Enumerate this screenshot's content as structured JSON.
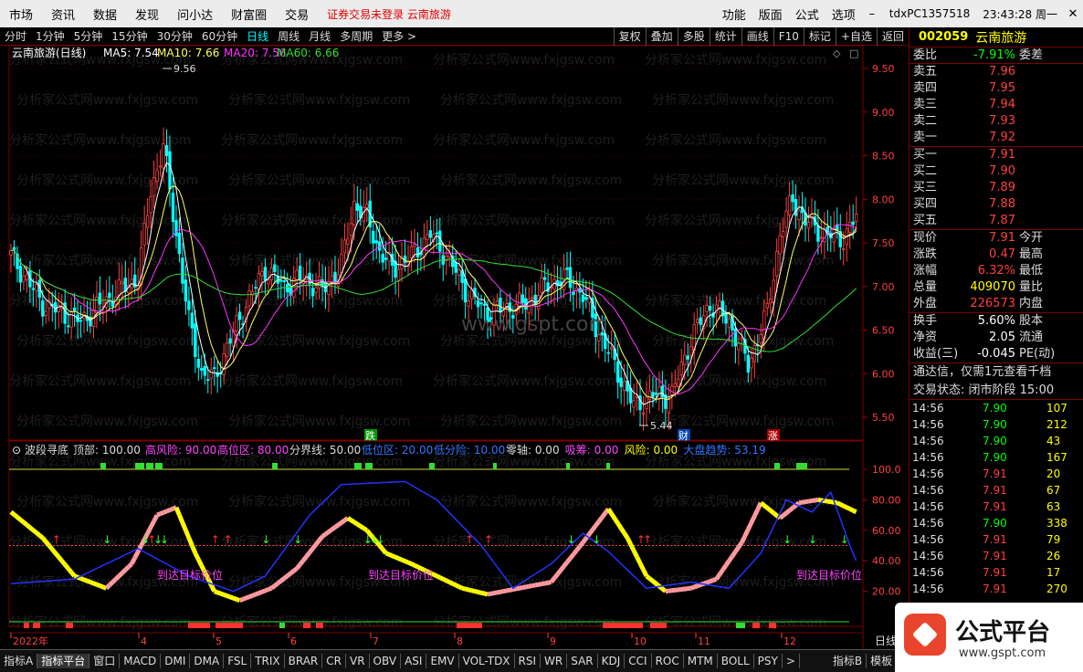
{
  "menu": {
    "items": [
      "市场",
      "资讯",
      "数据",
      "发现",
      "问小达",
      "财富圈",
      "交易"
    ],
    "warning": "证券交易未登录  云南旅游",
    "right_items": [
      "功能",
      "版面",
      "公式",
      "选项"
    ],
    "user": "tdxPC1357518",
    "clock": "23:43:28 周一"
  },
  "toolbar": {
    "periods": [
      "分时",
      "1分钟",
      "5分钟",
      "15分钟",
      "30分钟",
      "60分钟",
      "日线",
      "周线",
      "月线",
      "多周期",
      "更多 >"
    ],
    "active_period": "日线",
    "buttons": [
      "复权",
      "叠加",
      "多股",
      "统计",
      "画线",
      "F10",
      "标记",
      "+自选",
      "返回"
    ]
  },
  "main_chart": {
    "title": "云南旅游(日线)",
    "ma": [
      {
        "label": "MA5: 7.54",
        "color": "#ffffff"
      },
      {
        "label": "MA10: 7.66",
        "color": "#ffff66"
      },
      {
        "label": "MA20: 7.56",
        "color": "#ff33ff"
      },
      {
        "label": "MA60: 6.66",
        "color": "#33dd33"
      }
    ],
    "y_ticks": [
      "9.50",
      "9.00",
      "8.50",
      "8.00",
      "7.50",
      "7.00",
      "6.50",
      "6.00",
      "5.50"
    ],
    "high_label": "9.56",
    "low_label": "5.44",
    "markers": [
      "跌",
      "财",
      "涨"
    ],
    "watermark": "分析家公式网www.fxjgsw.com",
    "center_mark": "www.gspt.com"
  },
  "indicator": {
    "name": "波段寻底",
    "params": [
      {
        "label": "顶部: 100.00",
        "color": "#dddddd"
      },
      {
        "label": "高风险: 90.00",
        "color": "#ff44ff"
      },
      {
        "label": "高位区: 80.00",
        "color": "#ff44ff"
      },
      {
        "label": "分界线: 50.00",
        "color": "#dddddd"
      },
      {
        "label": "低位区: 20.00",
        "color": "#3377ff"
      },
      {
        "label": "低分险: 10.00",
        "color": "#3377ff"
      },
      {
        "label": "零轴: 0.00",
        "color": "#dddddd"
      },
      {
        "label": "吸筹: 0.00",
        "color": "#ff44ff"
      },
      {
        "label": "风险: 0.00",
        "color": "#ffff00"
      },
      {
        "label": "大盘趋势: 53.19",
        "color": "#3377ff"
      }
    ],
    "y_ticks": [
      "100.0",
      "80.00",
      "60.00",
      "40.00",
      "20.00"
    ],
    "annotation": "到达目标价位"
  },
  "x_axis": {
    "labels": [
      "2022年",
      "4",
      "5",
      "6",
      "7",
      "8",
      "9",
      "10",
      "11",
      "12"
    ],
    "tail": "日线"
  },
  "bottom_tabs": [
    "指标A",
    "指标平台",
    "窗口",
    "MACD",
    "DMI",
    "DMA",
    "FSL",
    "TRIX",
    "BRAR",
    "CR",
    "VR",
    "OBV",
    "ASI",
    "EMV",
    "VOL-TDX",
    "RSI",
    "WR",
    "SAR",
    "KDJ",
    "CCI",
    "ROC",
    "MTM",
    "BOLL",
    "PSY",
    ">",
    "指标B",
    "模板",
    "+"
  ],
  "quote": {
    "code": "002059",
    "name": "云南旅游",
    "weibi_label": "委比",
    "weibi_value": "-7.91%",
    "weicha_label": "委差",
    "asks": [
      {
        "label": "卖五",
        "price": "7.96"
      },
      {
        "label": "卖四",
        "price": "7.95"
      },
      {
        "label": "卖三",
        "price": "7.94"
      },
      {
        "label": "卖二",
        "price": "7.93"
      },
      {
        "label": "卖一",
        "price": "7.92"
      }
    ],
    "bids": [
      {
        "label": "买一",
        "price": "7.91"
      },
      {
        "label": "买二",
        "price": "7.90"
      },
      {
        "label": "买三",
        "price": "7.89"
      },
      {
        "label": "买四",
        "price": "7.88"
      },
      {
        "label": "买五",
        "price": "7.87"
      }
    ],
    "stats": [
      {
        "label": "现价",
        "value": "7.91",
        "right": "今开",
        "cls": "red"
      },
      {
        "label": "涨跌",
        "value": "0.47",
        "right": "最高",
        "cls": "red"
      },
      {
        "label": "涨幅",
        "value": "6.32%",
        "right": "最低",
        "cls": "red"
      },
      {
        "label": "总量",
        "value": "409070",
        "right": "量比",
        "cls": "yellow"
      },
      {
        "label": "外盘",
        "value": "226573",
        "right": "内盘",
        "cls": "red"
      }
    ],
    "stats2": [
      {
        "label": "换手",
        "value": "5.60%",
        "right": "股本",
        "cls": "white"
      },
      {
        "label": "净资",
        "value": "2.05",
        "right": "流通",
        "cls": "white"
      },
      {
        "label": "收益(三)",
        "value": "-0.045",
        "right": "PE(动)",
        "cls": "white"
      }
    ],
    "ad": "通达信，仅需1元查看千档",
    "status": "交易状态: 闭市阶段 15:00",
    "ticks": [
      {
        "time": "14:56",
        "price": "7.90",
        "vol": "107",
        "cls": "green"
      },
      {
        "time": "14:56",
        "price": "7.90",
        "vol": "212",
        "cls": "green"
      },
      {
        "time": "14:56",
        "price": "7.90",
        "vol": "43",
        "cls": "green"
      },
      {
        "time": "14:56",
        "price": "7.90",
        "vol": "167",
        "cls": "green"
      },
      {
        "time": "14:56",
        "price": "7.91",
        "vol": "20",
        "cls": "red"
      },
      {
        "time": "14:56",
        "price": "7.91",
        "vol": "67",
        "cls": "red"
      },
      {
        "time": "14:56",
        "price": "7.91",
        "vol": "63",
        "cls": "red"
      },
      {
        "time": "14:56",
        "price": "7.90",
        "vol": "338",
        "cls": "green"
      },
      {
        "time": "14:56",
        "price": "7.91",
        "vol": "79",
        "cls": "red"
      },
      {
        "time": "14:56",
        "price": "7.91",
        "vol": "26",
        "cls": "red"
      },
      {
        "time": "14:56",
        "price": "7.91",
        "vol": "17",
        "cls": "red"
      },
      {
        "time": "14:56",
        "price": "7.91",
        "vol": "270",
        "cls": "red"
      }
    ]
  },
  "logo": {
    "title": "公式平台",
    "url": "www.gspt.com"
  },
  "colors": {
    "up": "#ff4040",
    "down": "#00ffff",
    "accent_red": "#7a0000"
  }
}
